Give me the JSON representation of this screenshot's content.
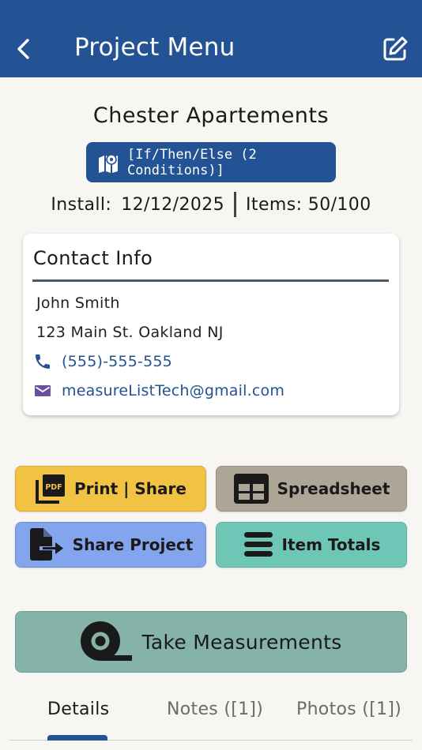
{
  "header": {
    "title": "Project Menu",
    "back_icon": "chevron-left-icon",
    "edit_icon": "edit-square-icon",
    "background": "#235394"
  },
  "project": {
    "name": "Chester Apartements",
    "rule_label": "[If/Then/Else (2 Conditions)]",
    "install_label": "Install:",
    "install_date": "12/12/2025",
    "items_text": "Items: 50/100"
  },
  "contact": {
    "title": "Contact Info",
    "name": "John Smith",
    "address": "123 Main St. Oakland NJ",
    "phone": "(555)-555-555",
    "email": "measureListTech@gmail.com",
    "link_color": "#23528f"
  },
  "actions": {
    "print_share": "Print | Share",
    "spreadsheet": "Spreadsheet",
    "share_project": "Share Project",
    "item_totals": "Item Totals",
    "take_measurements": "Take Measurements",
    "colors": {
      "print_share": "#f2c243",
      "spreadsheet": "#ada697",
      "share_project": "#83a5ed",
      "item_totals": "#6ec6b7",
      "take_measurements": "#85b3a9"
    }
  },
  "tabs": [
    {
      "label": "Details",
      "active": true
    },
    {
      "label": "Notes ([1])",
      "active": false
    },
    {
      "label": "Photos ([1])",
      "active": false
    }
  ]
}
